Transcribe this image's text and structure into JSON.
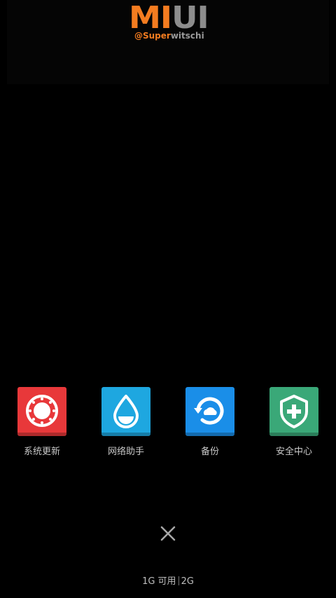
{
  "watermark": {
    "logo_mi": "MI",
    "logo_ui": "UI",
    "handle_prefix": "@Super",
    "handle_rest": "witschi"
  },
  "apps": [
    {
      "label": "系统更新",
      "icon": "system-update-icon",
      "color": "#e8383a"
    },
    {
      "label": "网络助手",
      "icon": "water-drop-icon",
      "color": "#1ea7e0"
    },
    {
      "label": "备份",
      "icon": "backup-restore-icon",
      "color": "#1a8ee8"
    },
    {
      "label": "安全中心",
      "icon": "shield-plus-icon",
      "color": "#3aa878"
    }
  ],
  "close": {
    "icon": "close-icon"
  },
  "memory": {
    "available": "1G 可用",
    "total": "2G"
  }
}
